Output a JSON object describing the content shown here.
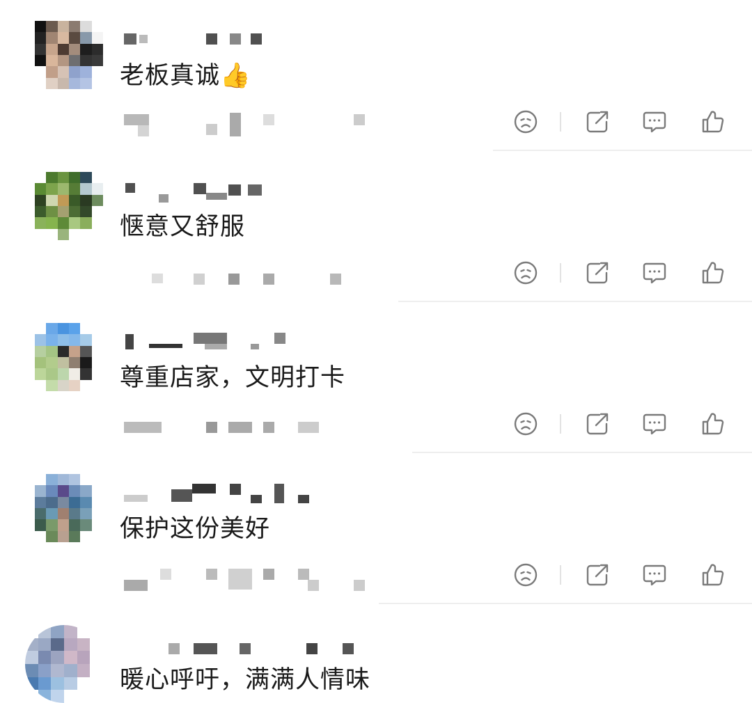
{
  "comments": [
    {
      "text": "老板真诚👍"
    },
    {
      "text": "惬意又舒服"
    },
    {
      "text": "尊重店家，文明打卡"
    },
    {
      "text": "保护这份美好"
    },
    {
      "text": "暖心呼吁，满满人情味"
    }
  ],
  "icons": {
    "dislike": "sad-face-icon",
    "share": "share-icon",
    "reply": "comment-bubble-icon",
    "like": "thumbs-up-icon"
  },
  "colors": {
    "text": "#1a1a1a",
    "icon": "#7a7a7a",
    "divider": "#eeeeee"
  }
}
